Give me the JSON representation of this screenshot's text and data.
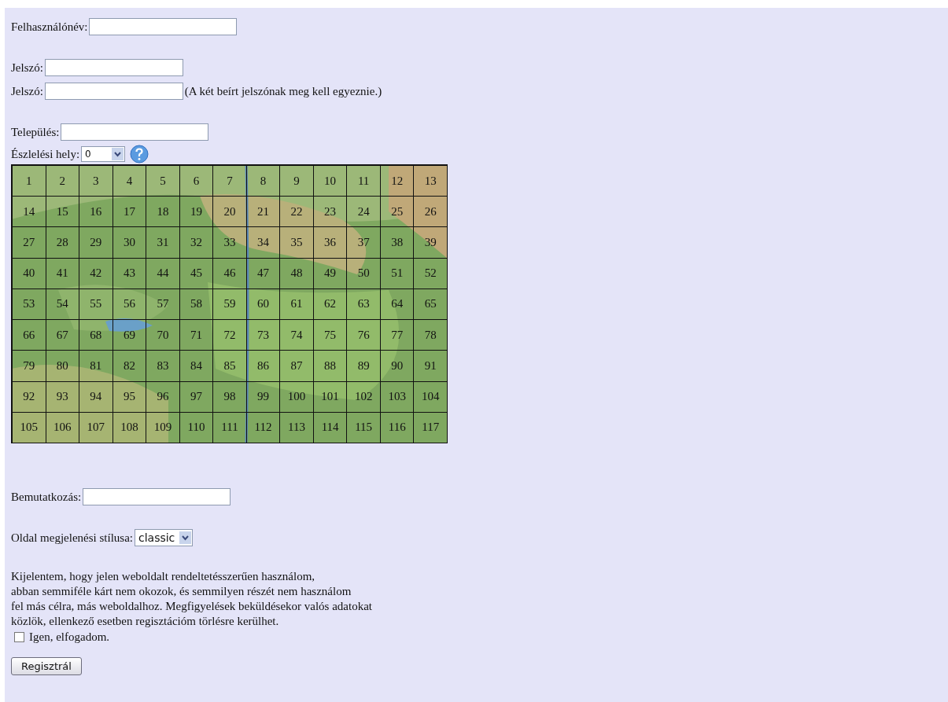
{
  "username": {
    "label": "Felhasználónév:"
  },
  "password": {
    "label": "Jelszó:"
  },
  "password_repeat": {
    "label": "Jelszó:",
    "hint": "(A két beírt jelszónak meg kell egyeznie.)"
  },
  "settlement": {
    "label": "Település:"
  },
  "observation_site": {
    "label": "Észlelési hely:",
    "value": "0"
  },
  "map_grid": {
    "rows": [
      [
        "1",
        "2",
        "3",
        "4",
        "5",
        "6",
        "7",
        "8",
        "9",
        "10",
        "11",
        "12",
        "13"
      ],
      [
        "14",
        "15",
        "16",
        "17",
        "18",
        "19",
        "20",
        "21",
        "22",
        "23",
        "24",
        "25",
        "26"
      ],
      [
        "27",
        "28",
        "29",
        "30",
        "31",
        "32",
        "33",
        "34",
        "35",
        "36",
        "37",
        "38",
        "39"
      ],
      [
        "40",
        "41",
        "42",
        "43",
        "44",
        "45",
        "46",
        "47",
        "48",
        "49",
        "50",
        "51",
        "52"
      ],
      [
        "53",
        "54",
        "55",
        "56",
        "57",
        "58",
        "59",
        "60",
        "61",
        "62",
        "63",
        "64",
        "65"
      ],
      [
        "66",
        "67",
        "68",
        "69",
        "70",
        "71",
        "72",
        "73",
        "74",
        "75",
        "76",
        "77",
        "78"
      ],
      [
        "79",
        "80",
        "81",
        "82",
        "83",
        "84",
        "85",
        "86",
        "87",
        "88",
        "89",
        "90",
        "91"
      ],
      [
        "92",
        "93",
        "94",
        "95",
        "96",
        "97",
        "98",
        "99",
        "100",
        "101",
        "102",
        "103",
        "104"
      ],
      [
        "105",
        "106",
        "107",
        "108",
        "109",
        "110",
        "111",
        "112",
        "113",
        "114",
        "115",
        "116",
        "117"
      ]
    ]
  },
  "introduction": {
    "label": "Bemutatkozás:"
  },
  "style": {
    "label": "Oldal megjelenési stílusa:",
    "value": "classic"
  },
  "terms": {
    "lines": [
      "Kijelentem, hogy jelen weboldalt rendeltetésszerűen használom,",
      "abban semmiféle kárt nem okozok, és semmilyen részét nem használom",
      "fel más célra, más weboldalhoz. Megfigyelések beküldésekor valós adatokat",
      "közlök, ellenkező esetben regisztációm törlésre kerülhet."
    ],
    "checkbox_label": "Igen, elfogadom.",
    "checked": false
  },
  "submit": "Regisztrál"
}
